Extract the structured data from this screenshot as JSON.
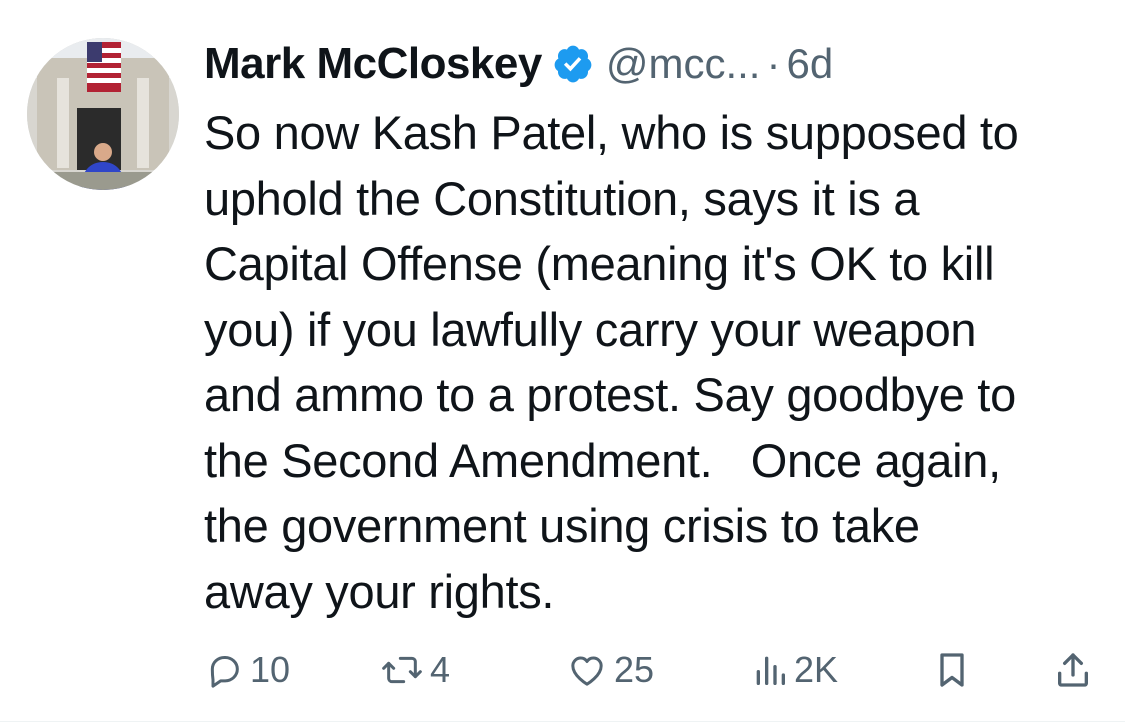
{
  "tweet": {
    "author": {
      "display_name": "Mark McCloskey",
      "verified": true,
      "verified_badge_color": "#1d9bf0",
      "handle": "@mcc...",
      "separator": "·",
      "time": "6d",
      "avatar_icon": "profile-photo"
    },
    "text": "So now Kash Patel, who is supposed to\nuphold the Constitution, says it is a\nCapital Offense (meaning it's OK to kill\nyou) if you lawfully carry your weapon\nand ammo to a protest. Say goodbye to\nthe Second Amendment.   Once again,\nthe government using crisis to take\naway your rights.",
    "actions": {
      "reply": {
        "icon": "reply-icon",
        "count": "10"
      },
      "repost": {
        "icon": "repost-icon",
        "count": "4"
      },
      "like": {
        "icon": "heart-icon",
        "count": "25"
      },
      "views": {
        "icon": "views-chart-icon",
        "count": "2K"
      },
      "bookmark": {
        "icon": "bookmark-icon"
      },
      "share": {
        "icon": "share-icon"
      }
    },
    "colors": {
      "text": "#0f1419",
      "secondary": "#536471",
      "background": "#ffffff"
    }
  }
}
